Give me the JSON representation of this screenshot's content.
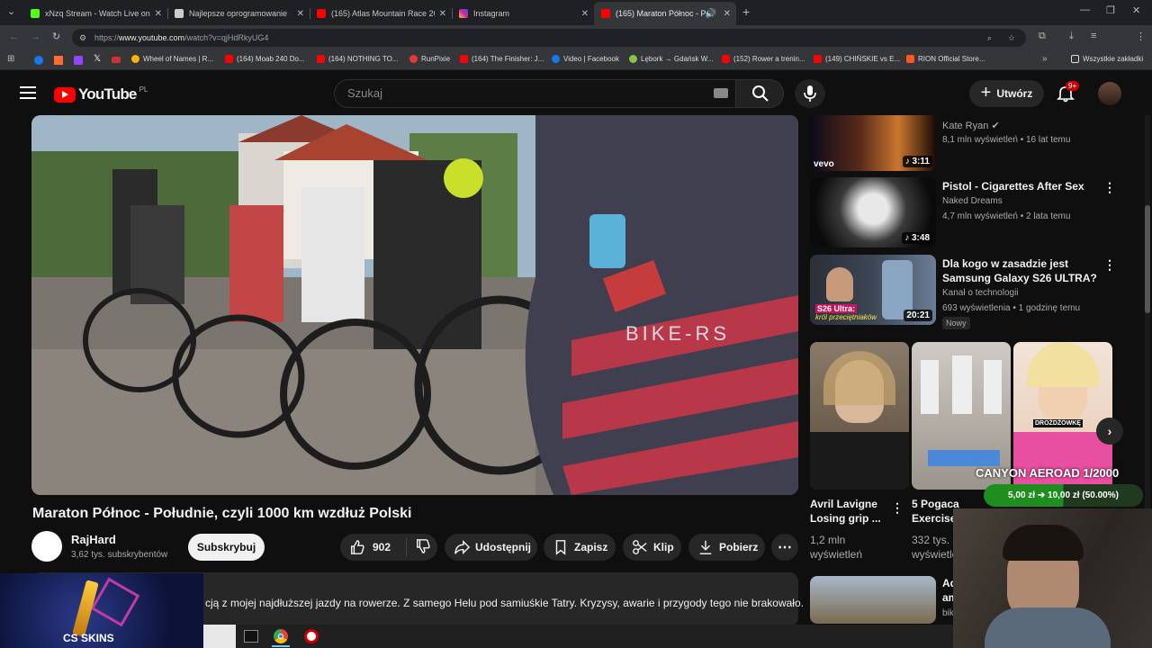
{
  "browser": {
    "tabs": [
      {
        "label": "xNzq Stream - Watch Live on K",
        "color": "#53fc18"
      },
      {
        "label": "Najlepsze oprogramowanie do",
        "color": "#888888"
      },
      {
        "label": "(165) Atlas Mountain Race 2025",
        "color": "#ff0000"
      },
      {
        "label": "Instagram",
        "color": "#d6249f"
      },
      {
        "label": "(165) Maraton Północ - Poł",
        "color": "#ff0000"
      }
    ],
    "url_prefix": "https://",
    "url_host": "www.youtube.com",
    "url_path": "/watch?v=qjHdRkyUG4",
    "bookmarks": [
      {
        "label": "Wheel of Names | R...",
        "color": "#ffb300"
      },
      {
        "label": "(164) Moab 240 Do...",
        "color": "#ff0000"
      },
      {
        "label": "(164) NOTHING TO...",
        "color": "#ff0000"
      },
      {
        "label": "RunPixie",
        "color": "#e53935"
      },
      {
        "label": "(164) The Finisher: J...",
        "color": "#ff0000"
      },
      {
        "label": "Video | Facebook",
        "color": "#1877f2"
      },
      {
        "label": "Lębork → Gdańsk W...",
        "color": "#8bc34a"
      },
      {
        "label": "(152) Rower a trenin...",
        "color": "#ff0000"
      },
      {
        "label": "(149) CHIŃSKIE vs E...",
        "color": "#ff0000"
      },
      {
        "label": "RION Official Store...",
        "color": "#ff5722"
      }
    ],
    "all_bookmarks": "Wszystkie zakładki"
  },
  "youtube": {
    "logo": "YouTube",
    "region": "PL",
    "search_placeholder": "Szukaj",
    "create_label": "Utwórz",
    "notif_count": "9+"
  },
  "video": {
    "title": "Maraton Północ - Południe, czyli 1000 km wzdłuż Polski",
    "channel": "RajHard",
    "subscribers": "3,62 tys. subskrybentów",
    "subscribe_label": "Subskrybuj",
    "likes": "902",
    "share_label": "Udostępnij",
    "save_label": "Zapisz",
    "clip_label": "Klip",
    "download_label": "Pobierz",
    "description": "cją z mojej najdłuższej jazdy na rowerze. Z samego Helu pod samiuśkie Tatry. Kryzysy, awarie i przygody tego nie brakowało."
  },
  "sidebar": {
    "videos": [
      {
        "title": "",
        "channel": "Kate Ryan",
        "meta": "8,1 mln wyświetleń • 16 lat temu",
        "duration": "3:11"
      },
      {
        "title": "Pistol - Cigarettes After Sex",
        "channel": "Naked Dreams",
        "meta": "4,7 mln wyświetleń • 2 lata temu",
        "duration": "3:48"
      },
      {
        "title_line1": "Dla kogo w zasadzie jest",
        "title_line2": "Samsung Galaxy S26 ULTRA?",
        "channel": "Kanał o technologii",
        "meta": "693 wyświetlenia • 1 godzinę temu",
        "duration": "20:21",
        "badge": "Nowy"
      }
    ],
    "shorts": [
      {
        "title_line1": "Avril Lavigne",
        "title_line2": "Losing grip ...",
        "views": "1,2 mln",
        "views2": "wyświetleń"
      },
      {
        "title_line1": "5 Pogaca",
        "title_line2": "Exercise",
        "views": "332 tys.",
        "views2": "wyświetleń"
      }
    ],
    "next_title_a": "Ad",
    "next_title_b": "am",
    "next_channel": "bik"
  },
  "overlays": {
    "canyon_text": "CANYON AEROAD 1/2000",
    "donation": "5,00 zł ➔ 10,00 zł (50.00%)",
    "sponsor": "CS SKINS",
    "thumb_text_1": "vevo",
    "thumb_text_2a": "S26 Ultra:",
    "thumb_text_2b": "król przeciętniaków",
    "thumb_text_3": "DROŻDŻÓWKĘ",
    "jersey_text": "BIKE-RS"
  }
}
